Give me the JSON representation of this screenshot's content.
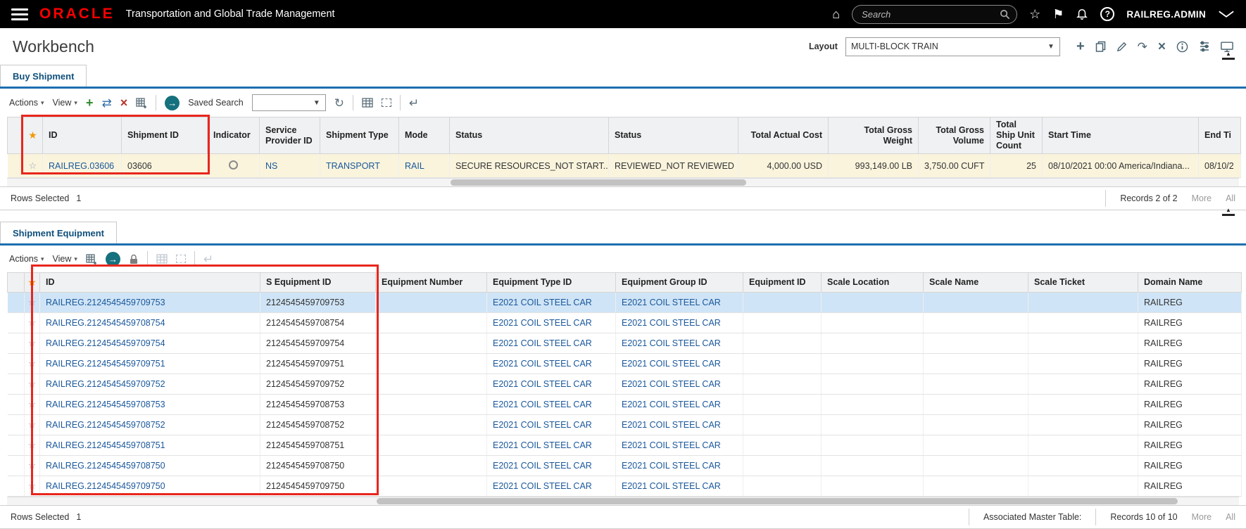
{
  "topbar": {
    "brand": "ORACLE",
    "app_title": "Transportation and Global Trade Management",
    "search_placeholder": "Search",
    "username": "RAILREG.ADMIN"
  },
  "workbench": {
    "title": "Workbench",
    "layout_label": "Layout",
    "layout_value": "MULTI-BLOCK TRAIN"
  },
  "icons": {
    "home": "⌂",
    "favorites": "☆",
    "flag": "⚑",
    "help": "?",
    "add": "+",
    "transfer": "⇄",
    "delete": "×",
    "go": "→",
    "refresh": "↻",
    "return": "↵",
    "caret": "▾",
    "star_header": "★",
    "star_row": "☆",
    "collapse": "▲"
  },
  "buy_shipment": {
    "tab": "Buy Shipment",
    "actions_label": "Actions",
    "view_label": "View",
    "saved_search_label": "Saved Search",
    "columns": [
      "ID",
      "Shipment ID",
      "Indicator",
      "Service Provider ID",
      "Shipment Type",
      "Mode",
      "Status",
      "Status",
      "Total Actual Cost",
      "Total Gross Weight",
      "Total Gross Volume",
      "Total Ship Unit Count",
      "Start Time",
      "End Ti"
    ],
    "row": {
      "id": "RAILREG.03606",
      "shipment_id": "03606",
      "service_provider_id": "NS",
      "shipment_type": "TRANSPORT",
      "mode": "RAIL",
      "status1": "SECURE RESOURCES_NOT START...",
      "status2": "REVIEWED_NOT REVIEWED",
      "total_actual_cost": "4,000.00 USD",
      "total_gross_weight": "993,149.00 LB",
      "total_gross_volume": "3,750.00 CUFT",
      "total_ship_unit_count": "25",
      "start_time": "08/10/2021 00:00 America/Indiana...",
      "end_time": "08/10/2"
    },
    "footer": {
      "rows_selected_label": "Rows Selected",
      "rows_selected_value": "1",
      "records": "Records 2 of 2",
      "more": "More",
      "all": "All"
    }
  },
  "shipment_equipment": {
    "tab": "Shipment Equipment",
    "actions_label": "Actions",
    "view_label": "View",
    "columns": [
      "ID",
      "S Equipment ID",
      "Equipment Number",
      "Equipment Type ID",
      "Equipment Group ID",
      "Equipment ID",
      "Scale Location",
      "Scale Name",
      "Scale Ticket",
      "Domain Name"
    ],
    "rows": [
      {
        "id": "RAILREG.2124545459709753",
        "s_equipment_id": "2124545459709753",
        "equipment_number": "",
        "equipment_type_id": "E2021 COIL STEEL CAR",
        "equipment_group_id": "E2021 COIL STEEL CAR",
        "equipment_id": "",
        "scale_location": "",
        "scale_name": "",
        "scale_ticket": "",
        "domain_name": "RAILREG"
      },
      {
        "id": "RAILREG.2124545459708754",
        "s_equipment_id": "2124545459708754",
        "equipment_number": "",
        "equipment_type_id": "E2021 COIL STEEL CAR",
        "equipment_group_id": "E2021 COIL STEEL CAR",
        "equipment_id": "",
        "scale_location": "",
        "scale_name": "",
        "scale_ticket": "",
        "domain_name": "RAILREG"
      },
      {
        "id": "RAILREG.2124545459709754",
        "s_equipment_id": "2124545459709754",
        "equipment_number": "",
        "equipment_type_id": "E2021 COIL STEEL CAR",
        "equipment_group_id": "E2021 COIL STEEL CAR",
        "equipment_id": "",
        "scale_location": "",
        "scale_name": "",
        "scale_ticket": "",
        "domain_name": "RAILREG"
      },
      {
        "id": "RAILREG.2124545459709751",
        "s_equipment_id": "2124545459709751",
        "equipment_number": "",
        "equipment_type_id": "E2021 COIL STEEL CAR",
        "equipment_group_id": "E2021 COIL STEEL CAR",
        "equipment_id": "",
        "scale_location": "",
        "scale_name": "",
        "scale_ticket": "",
        "domain_name": "RAILREG"
      },
      {
        "id": "RAILREG.2124545459709752",
        "s_equipment_id": "2124545459709752",
        "equipment_number": "",
        "equipment_type_id": "E2021 COIL STEEL CAR",
        "equipment_group_id": "E2021 COIL STEEL CAR",
        "equipment_id": "",
        "scale_location": "",
        "scale_name": "",
        "scale_ticket": "",
        "domain_name": "RAILREG"
      },
      {
        "id": "RAILREG.2124545459708753",
        "s_equipment_id": "2124545459708753",
        "equipment_number": "",
        "equipment_type_id": "E2021 COIL STEEL CAR",
        "equipment_group_id": "E2021 COIL STEEL CAR",
        "equipment_id": "",
        "scale_location": "",
        "scale_name": "",
        "scale_ticket": "",
        "domain_name": "RAILREG"
      },
      {
        "id": "RAILREG.2124545459708752",
        "s_equipment_id": "2124545459708752",
        "equipment_number": "",
        "equipment_type_id": "E2021 COIL STEEL CAR",
        "equipment_group_id": "E2021 COIL STEEL CAR",
        "equipment_id": "",
        "scale_location": "",
        "scale_name": "",
        "scale_ticket": "",
        "domain_name": "RAILREG"
      },
      {
        "id": "RAILREG.2124545459708751",
        "s_equipment_id": "2124545459708751",
        "equipment_number": "",
        "equipment_type_id": "E2021 COIL STEEL CAR",
        "equipment_group_id": "E2021 COIL STEEL CAR",
        "equipment_id": "",
        "scale_location": "",
        "scale_name": "",
        "scale_ticket": "",
        "domain_name": "RAILREG"
      },
      {
        "id": "RAILREG.2124545459708750",
        "s_equipment_id": "2124545459708750",
        "equipment_number": "",
        "equipment_type_id": "E2021 COIL STEEL CAR",
        "equipment_group_id": "E2021 COIL STEEL CAR",
        "equipment_id": "",
        "scale_location": "",
        "scale_name": "",
        "scale_ticket": "",
        "domain_name": "RAILREG"
      },
      {
        "id": "RAILREG.2124545459709750",
        "s_equipment_id": "2124545459709750",
        "equipment_number": "",
        "equipment_type_id": "E2021 COIL STEEL CAR",
        "equipment_group_id": "E2021 COIL STEEL CAR",
        "equipment_id": "",
        "scale_location": "",
        "scale_name": "",
        "scale_ticket": "",
        "domain_name": "RAILREG"
      }
    ],
    "footer": {
      "rows_selected_label": "Rows Selected",
      "rows_selected_value": "1",
      "associated_master_table_label": "Associated Master Table:",
      "records": "Records 10 of 10",
      "more": "More",
      "all": "All"
    }
  },
  "annotations": {
    "color": "#e8261c",
    "boxes": [
      "buy-shipment-id-columns",
      "equipment-id-columns"
    ]
  }
}
